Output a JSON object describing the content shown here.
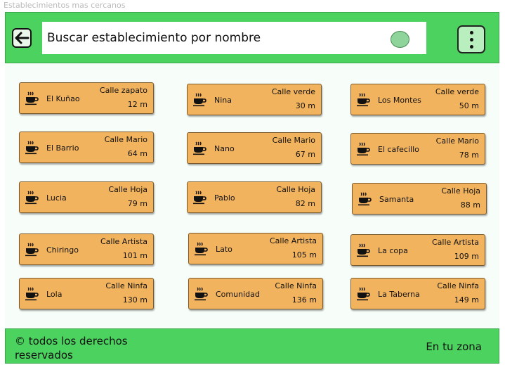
{
  "window_title": "Establecimientos mas cercanos",
  "header": {
    "back_icon": "arrow-left-icon",
    "search_placeholder": "Buscar establecimiento por nombre",
    "menu_icon": "vertical-dots-icon",
    "accent_color": "#4cd35f"
  },
  "establishments": [
    {
      "name": "El Kuñao",
      "street": "Calle zapato",
      "distance": "12 m"
    },
    {
      "name": "Nina",
      "street": "Calle verde",
      "distance": "30 m"
    },
    {
      "name": "Los Montes",
      "street": "Calle verde",
      "distance": "50 m"
    },
    {
      "name": "El Barrio",
      "street": "Calle Mario",
      "distance": "64 m"
    },
    {
      "name": "Nano",
      "street": "Calle Mario",
      "distance": "67 m"
    },
    {
      "name": "El cafecillo",
      "street": "Calle Mario",
      "distance": "78 m"
    },
    {
      "name": "Lucia",
      "street": "Calle Hoja",
      "distance": "79 m"
    },
    {
      "name": "Pablo",
      "street": "Calle Hoja",
      "distance": "82 m"
    },
    {
      "name": "Samanta",
      "street": "Calle Hoja",
      "distance": "88 m"
    },
    {
      "name": "Chiringo",
      "street": "Calle Artista",
      "distance": "101 m"
    },
    {
      "name": "Lato",
      "street": "Calle Artista",
      "distance": "105 m"
    },
    {
      "name": "La copa",
      "street": "Calle Artista",
      "distance": "109 m"
    },
    {
      "name": "Lola",
      "street": "Calle Ninfa",
      "distance": "130 m"
    },
    {
      "name": "Comunidad",
      "street": "Calle Ninfa",
      "distance": "136 m"
    },
    {
      "name": "La Taberna",
      "street": "Calle Ninfa",
      "distance": "149 m"
    }
  ],
  "card_icon": "coffee-cup-icon",
  "card_color": "#f2b35f",
  "footer": {
    "copyright": "© todos los derechos reservados",
    "zone_label": "En tu zona"
  }
}
